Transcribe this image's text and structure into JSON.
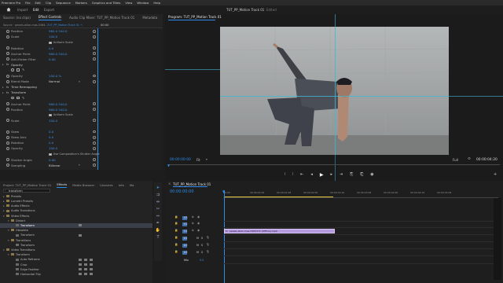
{
  "menu": {
    "items": [
      "Premiere Pro",
      "File",
      "Edit",
      "Clip",
      "Sequence",
      "Markers",
      "Graphics and Titles",
      "View",
      "Window",
      "Help"
    ],
    "workspaces": [
      "Import",
      "Edit",
      "Export"
    ],
    "active_workspace": "Edit",
    "doc_title": "TUT_PP_Motion Track 01",
    "doc_status": "Edited"
  },
  "source_tabs": [
    "Source: (no clips)",
    "Effect Controls",
    "Audio Clip Mixer: TUT_PP_Motion Track 01",
    "Metadata",
    "Text"
  ],
  "effect_controls": {
    "clip_path": "Source · pexels-allan-mas-5384...",
    "sequence": "TUT_PP_Motion Track 01 →",
    "time": "00:00",
    "rows": [
      {
        "label": "Position",
        "value": "960.0  540.0",
        "indent": 1
      },
      {
        "label": "Scale",
        "value": "100.0",
        "indent": 1
      },
      {
        "label": "",
        "value": "",
        "check": "Uniform Scale",
        "indent": 1
      },
      {
        "label": "Rotation",
        "value": "0.0",
        "indent": 1
      },
      {
        "label": "Anchor Point",
        "value": "960.0  540.0",
        "indent": 1
      },
      {
        "label": "Anti-flicker Filter",
        "value": "0.00",
        "indent": 1
      },
      {
        "label": "Opacity",
        "value": "",
        "section": true,
        "indent": 0
      },
      {
        "label": "",
        "value": "",
        "masks": true,
        "indent": 1
      },
      {
        "label": "Opacity",
        "value": "100.0 %",
        "indent": 1
      },
      {
        "label": "Blend Mode",
        "value": "Normal",
        "dropdown": true,
        "indent": 1
      },
      {
        "label": "Time Remapping",
        "value": "",
        "section": true,
        "indent": 0
      },
      {
        "label": "Transform",
        "value": "",
        "section": true,
        "indent": 0
      },
      {
        "label": "",
        "value": "",
        "masks": true,
        "indent": 1
      },
      {
        "label": "Anchor Point",
        "value": "960.0  540.0",
        "indent": 1
      },
      {
        "label": "Position",
        "value": "960.0  540.0",
        "indent": 1
      },
      {
        "label": "",
        "value": "",
        "check": "Uniform Scale",
        "indent": 1
      },
      {
        "label": "Scale",
        "value": "100.0",
        "indent": 1
      },
      {
        "label": "",
        "value": "",
        "indent": 1
      },
      {
        "label": "Skew",
        "value": "0.0",
        "indent": 1
      },
      {
        "label": "Skew Axis",
        "value": "0.0",
        "indent": 1
      },
      {
        "label": "Rotation",
        "value": "0.0",
        "indent": 1
      },
      {
        "label": "Opacity",
        "value": "100.0",
        "indent": 1
      },
      {
        "label": "",
        "value": "",
        "check": "Use Composition's Shutter Angle",
        "indent": 1
      },
      {
        "label": "Shutter Angle",
        "value": "0.00",
        "indent": 1
      },
      {
        "label": "Sampling",
        "value": "Bilinear",
        "dropdown": true,
        "indent": 1
      }
    ]
  },
  "program": {
    "title": "Program: TUT_PP_Motion Track 01",
    "timecode": "00:00:00:00",
    "fit": "Fit",
    "quality": "Full",
    "duration": "00:00:04:20"
  },
  "project": {
    "tabs": [
      "Project: TUT_PP_Motion Track 01",
      "Effects",
      "Media Browser",
      "Libraries",
      "Info",
      "Ma"
    ],
    "active_tab": "Effects",
    "search": "transform",
    "tree": [
      {
        "label": "Presets",
        "level": 0
      },
      {
        "label": "Lumetri Presets",
        "level": 0
      },
      {
        "label": "Audio Effects",
        "level": 0
      },
      {
        "label": "Audio Transitions",
        "level": 0
      },
      {
        "label": "Video Effects",
        "level": 0,
        "open": true
      },
      {
        "label": "Distort",
        "level": 1,
        "open": true
      },
      {
        "label": "Transform",
        "level": 2,
        "selected": true,
        "badges": 1
      },
      {
        "label": "Obsolete",
        "level": 1,
        "open": true
      },
      {
        "label": "Transform",
        "level": 2,
        "badges": 1
      },
      {
        "label": "Transitions",
        "level": 1,
        "open": true
      },
      {
        "label": "Transform",
        "level": 2
      },
      {
        "label": "Video Transitions",
        "level": 0,
        "open": true
      },
      {
        "label": "Transform",
        "level": 1,
        "open": true
      },
      {
        "label": "Auto Reframe",
        "level": 2,
        "badges": 3
      },
      {
        "label": "Crop",
        "level": 2,
        "badges": 3
      },
      {
        "label": "Edge Feather",
        "level": 2,
        "badges": 3
      },
      {
        "label": "Horizontal Flip",
        "level": 2,
        "badges": 3
      }
    ]
  },
  "timeline": {
    "title": "TUT_PP_Motion Track 01",
    "timecode": "00:00:00:00",
    "ruler": [
      "00:00",
      "00:00:00:16",
      "00:00:01:08",
      "00:00:02:00",
      "00:00:02:16",
      "00:00:03:08",
      "00:00:04:00",
      "00:00:04:16",
      "00:00:05:08"
    ],
    "tracks": [
      {
        "name": "V3",
        "kind": "video"
      },
      {
        "name": "V2",
        "kind": "video"
      },
      {
        "name": "V1",
        "kind": "video"
      },
      {
        "name": "A1",
        "kind": "audio"
      },
      {
        "name": "A2",
        "kind": "audio"
      },
      {
        "name": "A3",
        "kind": "audio"
      },
      {
        "name": "Mix",
        "kind": "mix",
        "value": "0.0"
      }
    ],
    "clip_label": "pexels-allan-mas-5384372 (Offline).mp4"
  },
  "colors": {
    "accent": "#2d8ceb",
    "clip": "#b69be0",
    "timecode": "#2d8ceb",
    "value": "#3d8de0"
  }
}
